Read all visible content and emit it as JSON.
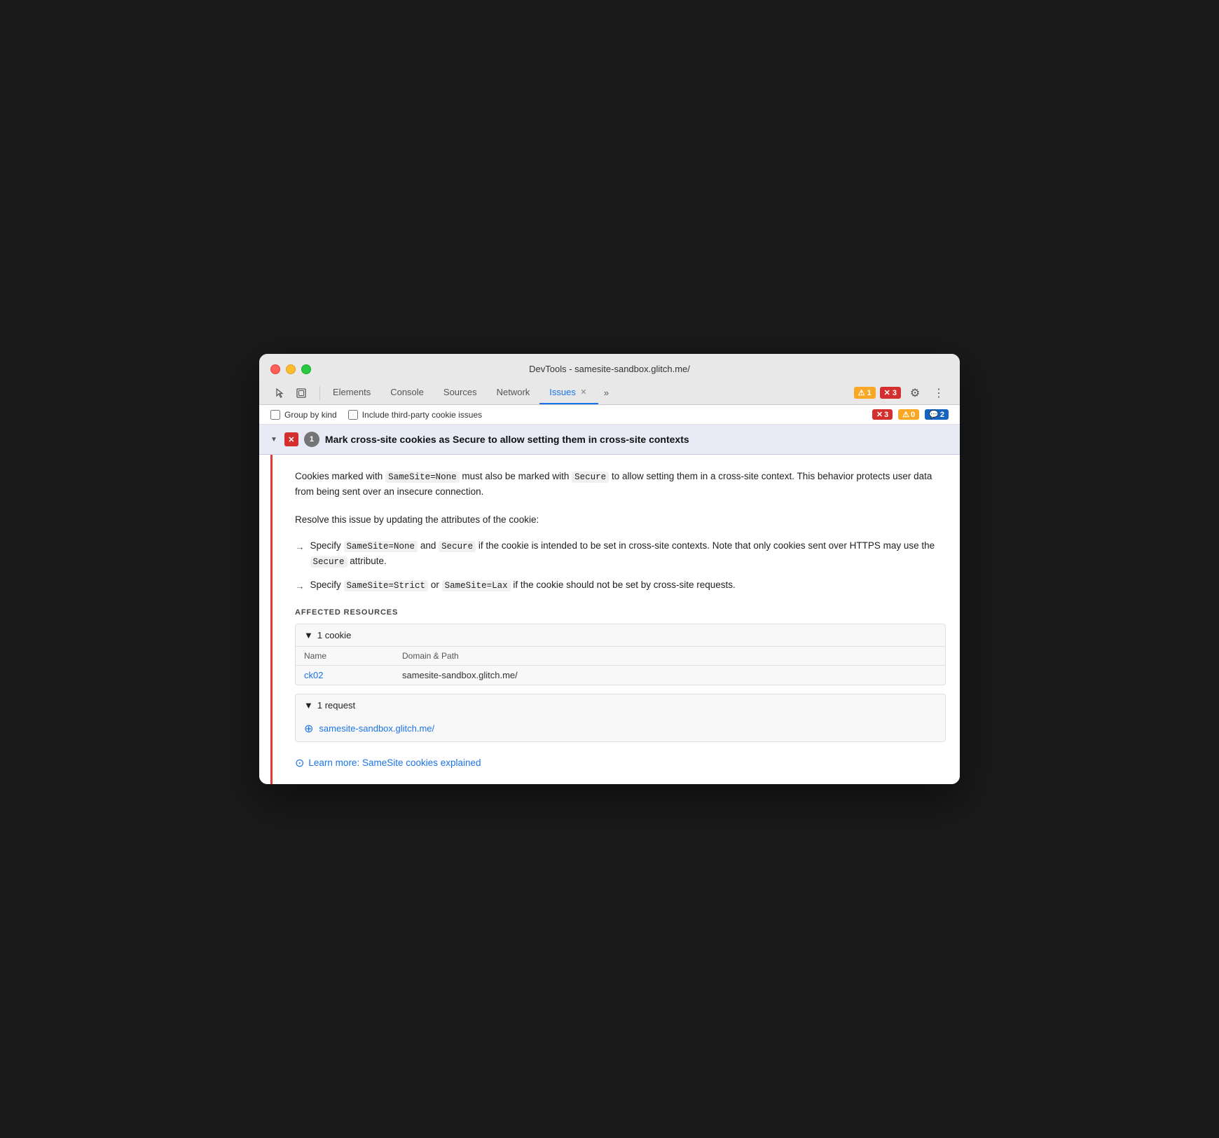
{
  "window": {
    "title": "DevTools - samesite-sandbox.glitch.me/"
  },
  "tabs": [
    {
      "id": "elements",
      "label": "Elements",
      "active": false,
      "closeable": false
    },
    {
      "id": "console",
      "label": "Console",
      "active": false,
      "closeable": false
    },
    {
      "id": "sources",
      "label": "Sources",
      "active": false,
      "closeable": false
    },
    {
      "id": "network",
      "label": "Network",
      "active": false,
      "closeable": false
    },
    {
      "id": "issues",
      "label": "Issues",
      "active": true,
      "closeable": true
    }
  ],
  "toolbar": {
    "more_label": "»",
    "warning_count": "1",
    "error_count": "3"
  },
  "filter_bar": {
    "group_by_kind_label": "Group by kind",
    "third_party_label": "Include third-party cookie issues",
    "error_count": "3",
    "warning_count": "0",
    "info_count": "2"
  },
  "issue": {
    "title": "Mark cross-site cookies as Secure to allow setting them in cross-site contexts",
    "count": "1",
    "description": "Cookies marked with SameSite=None must also be marked with Secure to allow setting them in a cross-site context. This behavior protects user data from being sent over an insecure connection.",
    "resolve_text": "Resolve this issue by updating the attributes of the cookie:",
    "bullets": [
      {
        "text_before": "Specify",
        "code1": "SameSite=None",
        "text_middle": "and",
        "code2": "Secure",
        "text_after": "if the cookie is intended to be set in cross-site contexts. Note that only cookies sent over HTTPS may use the",
        "code3": "Secure",
        "text_end": "attribute."
      },
      {
        "text_before": "Specify",
        "code1": "SameSite=Strict",
        "text_middle": "or",
        "code2": "SameSite=Lax",
        "text_after": "if the cookie should not be set by cross-site requests."
      }
    ],
    "affected_resources_label": "AFFECTED RESOURCES",
    "cookie_group": {
      "count_label": "1 cookie",
      "columns": [
        "Name",
        "Domain & Path"
      ],
      "rows": [
        {
          "name": "ck02",
          "domain": "samesite-sandbox.glitch.me/"
        }
      ]
    },
    "request_group": {
      "count_label": "1 request",
      "url": "samesite-sandbox.glitch.me/"
    },
    "learn_more_text": "Learn more: SameSite cookies explained"
  }
}
